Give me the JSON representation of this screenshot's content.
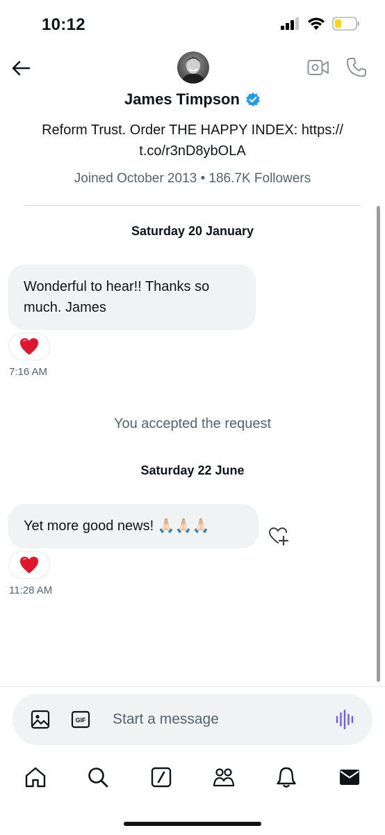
{
  "status_bar": {
    "time": "10:12",
    "icons": [
      "signal-icon",
      "wifi-icon",
      "battery-icon"
    ]
  },
  "header": {
    "name": "James Timpson",
    "verified": true,
    "icons": [
      "back-arrow-icon",
      "avatar",
      "video-call-icon",
      "phone-icon",
      "verified-badge-icon"
    ]
  },
  "profile": {
    "bio_line1": "Reform Trust. Order THE HAPPY INDEX: https://",
    "bio_line2": "t.co/r3nD8ybOLA",
    "joined": "Joined October 2013 • 186.7K Followers"
  },
  "conversation": {
    "date1": "Saturday 20 January",
    "msg1_line1": "Wonderful to hear!! Thanks so",
    "msg1_line2": "much. James",
    "msg1_reaction": "❤️",
    "msg1_time": "7:16 AM",
    "system_msg": "You accepted the request",
    "date2": "Saturday 22 June",
    "msg2_text": "Yet more good news! 🙏🏻🙏🏻🙏🏻",
    "msg2_reaction": "❤️",
    "msg2_time": "11:28 AM"
  },
  "composer": {
    "placeholder": "Start a message",
    "gif_label": "GIF",
    "icons": [
      "image-icon",
      "gif-icon",
      "voice-message-icon"
    ]
  },
  "bottom_nav": [
    "home-icon",
    "search-icon",
    "grok-icon",
    "communities-icon",
    "notifications-icon",
    "messages-icon"
  ],
  "colors": {
    "accent": "#1d9bf0",
    "voice": "#7856ff",
    "bubble": "#eff3f4",
    "secondary_text": "#536471",
    "heart": "#e0162b"
  }
}
